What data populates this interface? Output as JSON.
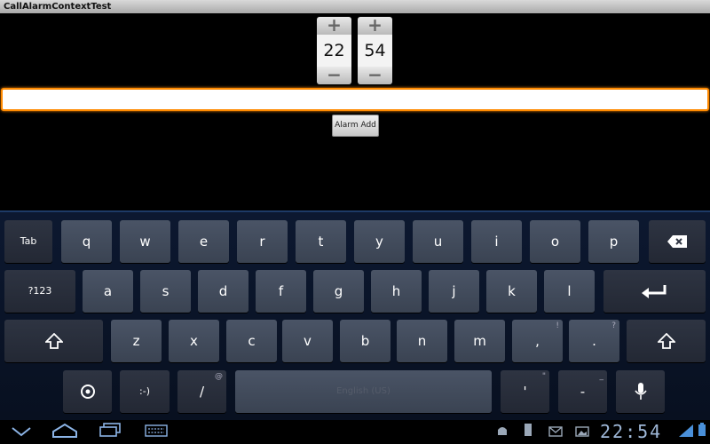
{
  "window": {
    "title": "CallAlarmContextTest"
  },
  "time_picker": {
    "hour": "22",
    "minute": "54",
    "increment_glyph": "+",
    "decrement_glyph": "−"
  },
  "form": {
    "input_value": "",
    "add_button_label": "Alarm Add"
  },
  "keyboard": {
    "row1": [
      "Tab",
      "q",
      "w",
      "e",
      "r",
      "t",
      "y",
      "u",
      "i",
      "o",
      "p"
    ],
    "row2": [
      "?123",
      "a",
      "s",
      "d",
      "f",
      "g",
      "h",
      "j",
      "k",
      "l"
    ],
    "row3": [
      "z",
      "x",
      "c",
      "v",
      "b",
      "n",
      "m",
      ",",
      "."
    ],
    "row3_hints": [
      "!",
      "?"
    ],
    "row4": [
      ":-)",
      "/",
      "'",
      "-"
    ],
    "row4_hints": [
      "@",
      "\"",
      "_"
    ],
    "space_label": "English (US)"
  },
  "status": {
    "clock": "22:54"
  },
  "colors": {
    "focus": "#ff8a00",
    "keyboard_bg": "#0c1830",
    "key": "#4a5466"
  }
}
